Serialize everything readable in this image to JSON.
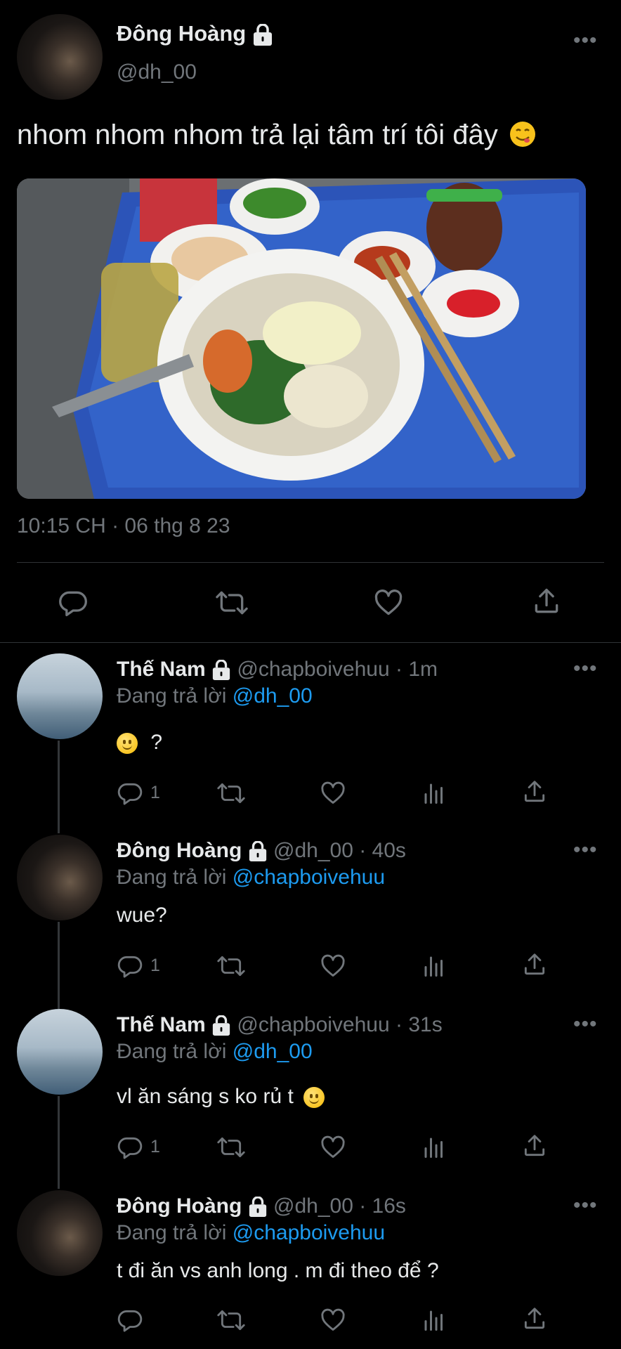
{
  "main_tweet": {
    "author_name": "Đông Hoàng",
    "handle": "@dh_00",
    "text": "nhom nhom nhom trả lại tâm trí tôi đây",
    "emoji": "yum-face-emoji",
    "timestamp": "10:15 CH · 06 thg 8 23"
  },
  "replies": [
    {
      "author_name": "Thế Nam",
      "handle_time": "@chapboivehuu · 1m",
      "reply_prefix": "Đang trả lời",
      "reply_to": "@dh_00",
      "text": "?",
      "reply_count": "1"
    },
    {
      "author_name": "Đông Hoàng",
      "handle_time": "@dh_00 · 40s",
      "reply_prefix": "Đang trả lời",
      "reply_to": "@chapboivehuu",
      "text": "wue?",
      "reply_count": "1"
    },
    {
      "author_name": "Thế Nam",
      "handle_time": "@chapboivehuu · 31s",
      "reply_prefix": "Đang trả lời",
      "reply_to": "@dh_00",
      "text": "vl ăn sáng s ko rủ t",
      "reply_count": "1"
    },
    {
      "author_name": "Đông Hoàng",
      "handle_time": "@dh_00 · 16s",
      "reply_prefix": "Đang trả lời",
      "reply_to": "@chapboivehuu",
      "text": "t đi ăn vs anh long . m đi theo để ?",
      "reply_count": ""
    }
  ],
  "colors": {
    "background": "#000000",
    "text": "#e7e9ea",
    "secondary": "#71767b",
    "link": "#1d9bf0"
  }
}
